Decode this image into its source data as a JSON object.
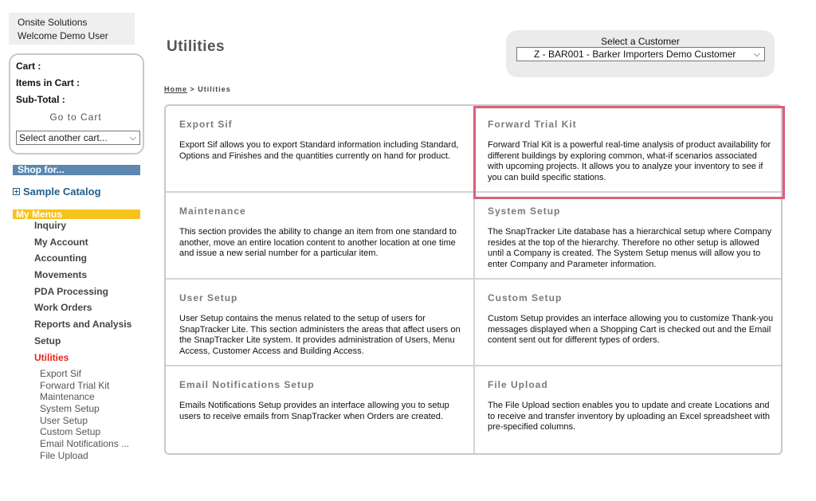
{
  "header": {
    "company": "Onsite Solutions",
    "welcome": "Welcome Demo User"
  },
  "cart": {
    "cart_label": "Cart :",
    "items_label": "Items in Cart :",
    "subtotal_label": "Sub-Total :",
    "go_to_cart": "Go to Cart",
    "select_cart": "Select another cart..."
  },
  "sidebar": {
    "shop_for": "Shop for...",
    "sample_catalog": "Sample Catalog",
    "my_menus": "My Menus",
    "menu_items": [
      "Inquiry",
      "My Account",
      "Accounting",
      "Movements",
      "PDA Processing",
      "Work Orders",
      "Reports and Analysis",
      "Setup",
      "Utilities"
    ],
    "active_menu": "Utilities",
    "sub_items": [
      "Export Sif",
      "Forward Trial Kit",
      "Maintenance",
      "System Setup",
      "User Setup",
      "Custom Setup",
      "Email Notifications ...",
      "File Upload"
    ]
  },
  "main": {
    "title": "Utilities",
    "breadcrumb_home": "Home",
    "breadcrumb_sep": " > ",
    "breadcrumb_current": "Utilities",
    "customer_label": "Select a Customer",
    "customer_value": "Z - BAR001 - Barker Importers Demo Customer",
    "cells": [
      {
        "title": "Export Sif",
        "desc": "Export Sif allows you to export Standard information including Standard, Options and Finishes and the quantities currently on hand for product."
      },
      {
        "title": "Forward Trial Kit",
        "desc": "Forward Trial Kit is a powerful real-time analysis of product availability for different buildings by exploring common, what-if scenarios associated with upcoming projects. It allows you to analyze your inventory to see if you can build specific stations."
      },
      {
        "title": "Maintenance",
        "desc": "This section provides the ability to change an item from one standard to another, move an entire location content to another location at one time and issue a new serial number for a particular item."
      },
      {
        "title": "System Setup",
        "desc": "The SnapTracker Lite database has a hierarchical setup where Company resides at the top of the hierarchy. Therefore no other setup is allowed until a Company is created. The System Setup menus will allow you to enter Company and Parameter information."
      },
      {
        "title": "User Setup",
        "desc": "User Setup contains the menus related to the setup of users for SnapTracker Lite. This section administers the areas that affect users on the SnapTracker Lite system. It provides administration of Users, Menu Access, Customer Access and Building Access."
      },
      {
        "title": "Custom Setup",
        "desc": "Custom Setup provides an interface allowing you to customize Thank-you messages displayed when a Shopping Cart is checked out and the Email content sent out for different types of orders."
      },
      {
        "title": "Email Notifications Setup",
        "desc": "Emails Notifications Setup provides an interface allowing you to setup users to receive emails from SnapTracker when Orders are created."
      },
      {
        "title": "File Upload",
        "desc": "The File Upload section enables you to update and create Locations and to receive and transfer inventory by uploading an Excel spreadsheet with pre-specified columns."
      }
    ]
  },
  "colors": {
    "shop_bar": "#5b87b0",
    "menus_bar": "#f7c21b",
    "active": "#e8211c",
    "highlight": "#d9607a"
  }
}
